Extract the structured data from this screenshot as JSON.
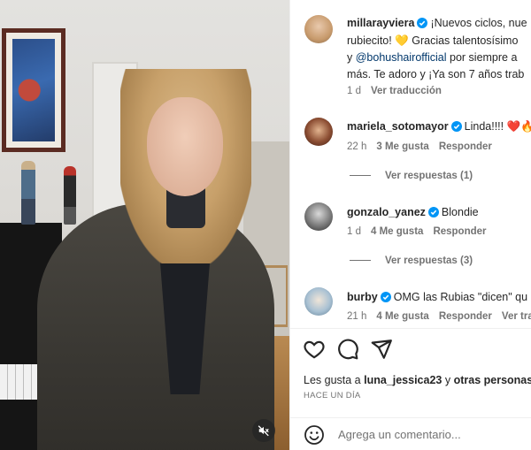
{
  "post": {
    "author": "millarayviera",
    "caption_lines": [
      "¡Nuevos ciclos, nue",
      "rubiecito! 💛 Gracias talentosísimo",
      "y ",
      "más. Te adoro y ¡Ya son 7 años trab"
    ],
    "caption_mention": "@bohushairofficial",
    "caption_line3_rest": " por siempre a",
    "time": "1 d",
    "translate": "Ver traducción"
  },
  "comments": [
    {
      "user": "mariela_sotomayor",
      "text": "Linda!!!! ❤️🔥",
      "time": "22 h",
      "likes": "3 Me gusta",
      "reply": "Responder",
      "view_replies": "Ver respuestas (1)",
      "avatar_color": "#6b3a2a"
    },
    {
      "user": "gonzalo_yanez",
      "text": "Blondie",
      "time": "1 d",
      "likes": "4 Me gusta",
      "reply": "Responder",
      "view_replies": "Ver respuestas (3)",
      "avatar_color": "#8a8a8a"
    },
    {
      "user": "burby",
      "text": "OMG las Rubias \"dicen\" qu",
      "time": "21 h",
      "likes": "4 Me gusta",
      "reply": "Responder",
      "extra": "Ver trad",
      "avatar_color": "#9fb7c9"
    }
  ],
  "likes_line": {
    "prefix": "Les gusta a ",
    "user": "luna_jessica23",
    "middle": " y ",
    "rest": "otras personas"
  },
  "posted_ago": "HACE UN DÍA",
  "composer": {
    "placeholder": "Agrega un comentario..."
  },
  "icons": {
    "like": "heart-icon",
    "comment": "comment-icon",
    "share": "send-icon",
    "emoji": "emoji-icon",
    "mute": "speaker-muted-icon",
    "verified": "verified-badge-icon"
  },
  "colors": {
    "verified": "#0095f6",
    "link": "#00376b",
    "muted_text": "#737373"
  }
}
